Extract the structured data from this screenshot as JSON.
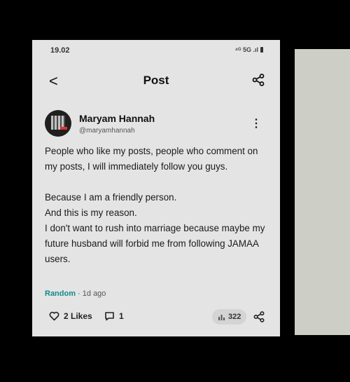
{
  "status_bar": {
    "time": "19.02",
    "indicators": "⁴ᴳ 5G .ıl"
  },
  "header": {
    "back_icon": "<",
    "title": "Post"
  },
  "post": {
    "author_name": "Maryam Hannah",
    "author_handle": "@maryamhannah",
    "paragraph1": "People who like my posts, people who comment on my posts, I will immediately follow you guys.",
    "paragraph2": " Because I am a friendly person.\n And this is my reason.\nI don't want to rush into marriage because maybe my future husband will forbid me from following JAMAA users.",
    "category": "Random",
    "time_ago": " · 1d ago"
  },
  "actions": {
    "likes": "2 Likes",
    "comments": "1",
    "views": "322"
  }
}
